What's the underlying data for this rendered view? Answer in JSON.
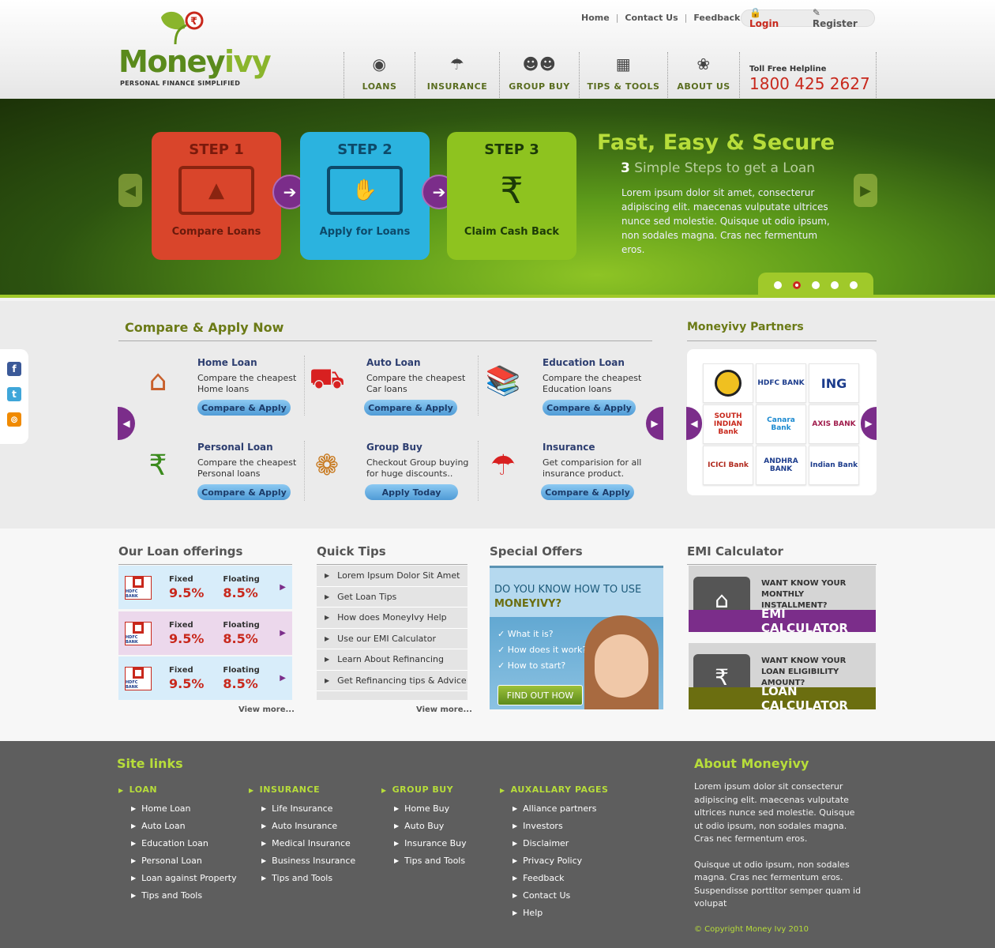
{
  "header": {
    "logo": {
      "text_main": "Money",
      "text_accent": "ivy",
      "tagline": "PERSONAL FINANCE SIMPLIFIED"
    },
    "top_links": [
      "Home",
      "Contact Us",
      "Feedback"
    ],
    "login": "Login",
    "register": "Register",
    "nav": [
      {
        "label": "LOANS",
        "icon": "money-bag-icon"
      },
      {
        "label": "INSURANCE",
        "icon": "umbrella-icon"
      },
      {
        "label": "GROUP BUY",
        "icon": "group-icon"
      },
      {
        "label": "TIPS & TOOLS",
        "icon": "calculator-icon"
      },
      {
        "label": "ABOUT US",
        "icon": "plant-icon"
      }
    ],
    "helpline": {
      "label": "Toll Free Helpline",
      "number": "1800 425 2627"
    }
  },
  "banner": {
    "steps": [
      {
        "step": "STEP 1",
        "caption": "Compare Loans",
        "color": "#d9452b"
      },
      {
        "step": "STEP 2",
        "caption": "Apply for Loans",
        "color": "#2bb3df"
      },
      {
        "step": "STEP 3",
        "caption": "Claim Cash Back",
        "color": "#8ec31f"
      }
    ],
    "title": "Fast, Easy & Secure",
    "subtitle_num": "3",
    "subtitle": "Simple Steps to get a Loan",
    "body": "Lorem ipsum dolor sit amet, consecterur adipiscing elit. maecenas vulputate ultrices nunce sed molestie. Quisque ut odio ipsum, non sodales magna. Cras nec fermentum eros.",
    "active_slide": 2,
    "slide_count": 5
  },
  "compare": {
    "heading": "Compare & Apply Now",
    "items": [
      {
        "title": "Home Loan",
        "desc": "Compare the cheapest Home loans",
        "button": "Compare & Apply",
        "icon": "house-icon"
      },
      {
        "title": "Auto Loan",
        "desc": "Compare the cheapest Car loans",
        "button": "Compare & Apply",
        "icon": "car-icon"
      },
      {
        "title": "Education Loan",
        "desc": "Compare the cheapest Education loans",
        "button": "Compare & Apply",
        "icon": "books-icon"
      },
      {
        "title": "Personal Loan",
        "desc": "Compare the cheapest Personal loans",
        "button": "Compare & Apply",
        "icon": "money-bag-icon"
      },
      {
        "title": "Group Buy",
        "desc": "Checkout Group buying for huge discounts..",
        "button": "Apply Today",
        "icon": "people-circle-icon"
      },
      {
        "title": "Insurance",
        "desc": "Get comparision for all insurance product.",
        "button": "Compare & Apply",
        "icon": "umbrella-icon"
      }
    ]
  },
  "partners": {
    "heading": "Moneyivy Partners",
    "logos": [
      {
        "name": "",
        "icon": "lion-emblem-icon"
      },
      {
        "name": "HDFC BANK",
        "color": "#1c3c8c"
      },
      {
        "name": "ING",
        "color": "#f08a00"
      },
      {
        "name": "SOUTH INDIAN Bank",
        "color": "#c8281c"
      },
      {
        "name": "Canara Bank",
        "color": "#1c8ad0"
      },
      {
        "name": "AXIS BANK",
        "color": "#a01c4c"
      },
      {
        "name": "ICICI Bank",
        "color": "#b0281c"
      },
      {
        "name": "ANDHRA BANK",
        "color": "#1c3c8c"
      },
      {
        "name": "Indian Bank",
        "color": "#1c3c8c"
      }
    ]
  },
  "loan_offerings": {
    "heading": "Our Loan offerings",
    "rows": [
      {
        "bank": "HDFC BANK",
        "fixed_label": "Fixed",
        "fixed": "9.5%",
        "floating_label": "Floating",
        "floating": "8.5%",
        "bg": "#d8edfa"
      },
      {
        "bank": "HDFC BANK",
        "fixed_label": "Fixed",
        "fixed": "9.5%",
        "floating_label": "Floating",
        "floating": "8.5%",
        "bg": "#ecd8ec"
      },
      {
        "bank": "HDFC BANK",
        "fixed_label": "Fixed",
        "fixed": "9.5%",
        "floating_label": "Floating",
        "floating": "8.5%",
        "bg": "#d8edfa"
      }
    ],
    "view_more": "View more..."
  },
  "quick_tips": {
    "heading": "Quick Tips",
    "items": [
      "Lorem Ipsum Dolor Sit Amet",
      "Get Loan Tips",
      "How does MoneyIvy Help",
      "Use our EMI Calculator",
      "Learn About Refinancing",
      "Get Refinancing tips & Advice"
    ],
    "view_more": "View more..."
  },
  "special_offers": {
    "heading": "Special Offers",
    "line1": "DO YOU KNOW HOW TO USE",
    "line2": "MONEYIVY?",
    "checks": [
      "What it is?",
      "How does it work?",
      "How to start?"
    ],
    "button": "FIND OUT HOW"
  },
  "emi": {
    "heading": "EMI Calculator",
    "boxes": [
      {
        "question": "WANT KNOW YOUR MONTHLY INSTALLMENT?",
        "label": "EMI CALCULATOR",
        "color": "#7b2d8a"
      },
      {
        "question": "WANT KNOW YOUR LOAN ELIGIBILITY AMOUNT?",
        "label": "LOAN CALCULATOR",
        "color": "#6b6e10"
      }
    ]
  },
  "footer": {
    "site_links_heading": "Site links",
    "columns": [
      {
        "heading": "LOAN",
        "links": [
          "Home Loan",
          "Auto Loan",
          "Education Loan",
          "Personal Loan",
          "Loan against Property",
          "Tips and Tools"
        ]
      },
      {
        "heading": "INSURANCE",
        "links": [
          "Life Insurance",
          "Auto Insurance",
          "Medical Insurance",
          "Business Insurance",
          "Tips and Tools"
        ]
      },
      {
        "heading": "GROUP BUY",
        "links": [
          "Home Buy",
          "Auto Buy",
          "Insurance Buy",
          "Tips and Tools"
        ]
      },
      {
        "heading": "AUXALLARY PAGES",
        "links": [
          "Alliance partners",
          "Investors",
          "Disclaimer",
          "Privacy Policy",
          "Feedback",
          "Contact Us",
          "Help"
        ]
      }
    ],
    "about_heading": "About Moneyivy",
    "about_p1": "Lorem ipsum dolor sit  consecterur adipiscing elit. maecenas vulputate ultrices nunce sed molestie. Quisque ut odio ipsum, non sodales magna. Cras nec fermentum eros.",
    "about_p2": "Quisque ut odio ipsum, non sodales magna. Cras nec fermentum eros. Suspendisse porttitor semper quam id volupat",
    "copyright": "© Copyright Money Ivy 2010"
  }
}
